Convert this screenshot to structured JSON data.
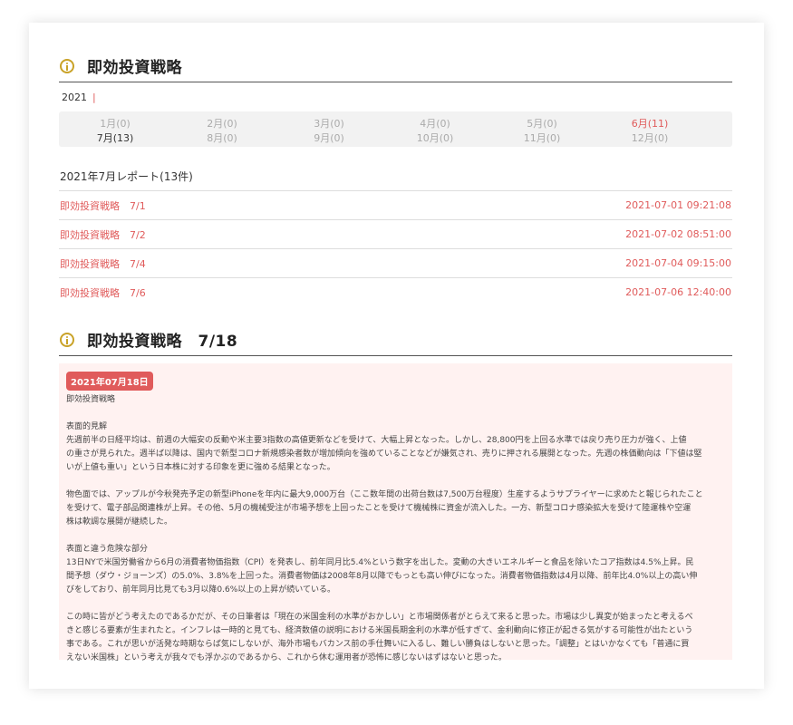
{
  "section1": {
    "title": "即効投資戦略"
  },
  "year": {
    "label": "2021",
    "separator": "|"
  },
  "months": [
    {
      "label": "1月(0)"
    },
    {
      "label": "2月(0)"
    },
    {
      "label": "3月(0)"
    },
    {
      "label": "4月(0)"
    },
    {
      "label": "5月(0)"
    },
    {
      "label": "6月(11)"
    },
    {
      "label": "7月(13)"
    },
    {
      "label": "8月(0)"
    },
    {
      "label": "9月(0)"
    },
    {
      "label": "10月(0)"
    },
    {
      "label": "11月(0)"
    },
    {
      "label": "12月(0)"
    }
  ],
  "report": {
    "title": "2021年7月レポート(13件)",
    "items": [
      {
        "title": "即効投資戦略　7/1",
        "time": "2021-07-01 09:21:08"
      },
      {
        "title": "即効投資戦略　7/2",
        "time": "2021-07-02 08:51:00"
      },
      {
        "title": "即効投資戦略　7/4",
        "time": "2021-07-04 09:15:00"
      },
      {
        "title": "即効投資戦略　7/6",
        "time": "2021-07-06 12:40:00"
      }
    ]
  },
  "section2": {
    "title": "即効投資戦略　7/18"
  },
  "detail": {
    "date": "2021年07月18日",
    "subtitle": "即効投資戦略",
    "p1_head": "表面的見解",
    "p1_l1": "先週前半の日経平均は、前週の大幅安の反動や米主要3指数の高値更新などを受けて、大幅上昇となった。しかし、28,800円を上回る水準では戻り売り圧力が強く、上値",
    "p1_l2": "の重さが見られた。週半ば以降は、国内で新型コロナ新規感染者数が増加傾向を強めていることなどが嫌気され、売りに押される展開となった。先週の株価動向は「下値は堅",
    "p1_l3": "いが上値も重い」という日本株に対する印象を更に強める結果となった。",
    "p2_l1": "物色面では、アップルが今秋発売予定の新型iPhoneを年内に最大9,000万台（ここ数年間の出荷台数は7,500万台程度）生産するようサプライヤーに求めたと報じられたこと",
    "p2_l2": "を受けて、電子部品関連株が上昇。その他、5月の機械受注が市場予想を上回ったことを受けて機械株に資金が流入した。一方、新型コロナ感染拡大を受けて陸運株や空運",
    "p2_l3": "株は軟調な展開が継続した。",
    "p3_head": "表面と違う危険な部分",
    "p3_l1": "13日NYで米国労働省から6月の消費者物価指数（CPI）を発表し、前年同月比5.4%という数字を出した。変動の大きいエネルギーと食品を除いたコア指数は4.5%上昇。民",
    "p3_l2": "間予想（ダウ・ジョーンズ）の5.0%、3.8%を上回った。消費者物価は2008年8月以降でもっとも高い伸びになった。消費者物価指数は4月以降、前年比4.0%以上の高い伸",
    "p3_l3": "びをしており、前年同月比見ても3月以降0.6%以上の上昇が続いている。",
    "p4_l1": "この時に皆がどう考えたのであるかだが、その日筆者は「現在の米国金利の水準がおかしい」と市場関係者がとらえて来ると思った。市場は少し異変が始まったと考えるべ",
    "p4_l2": "きと感じる要素が生まれたと。インフレは一時的と見ても、経済数値の説明における米国長期金利の水準が低すぎて、金利動向に修正が起きる気がする可能性が出たという",
    "p4_l3": "事である。これが思いが活発な時期ならば気にしないが、海外市場もバカンス前の手仕舞いに入るし、難しい勝負はしないと思った。「調整」とはいかなくても「普通に買",
    "p4_l4": "えない米国株」という考えが我々でも浮かぶのであるから、これから休む運用者が恐怖に感じないはずはないと思った。"
  }
}
